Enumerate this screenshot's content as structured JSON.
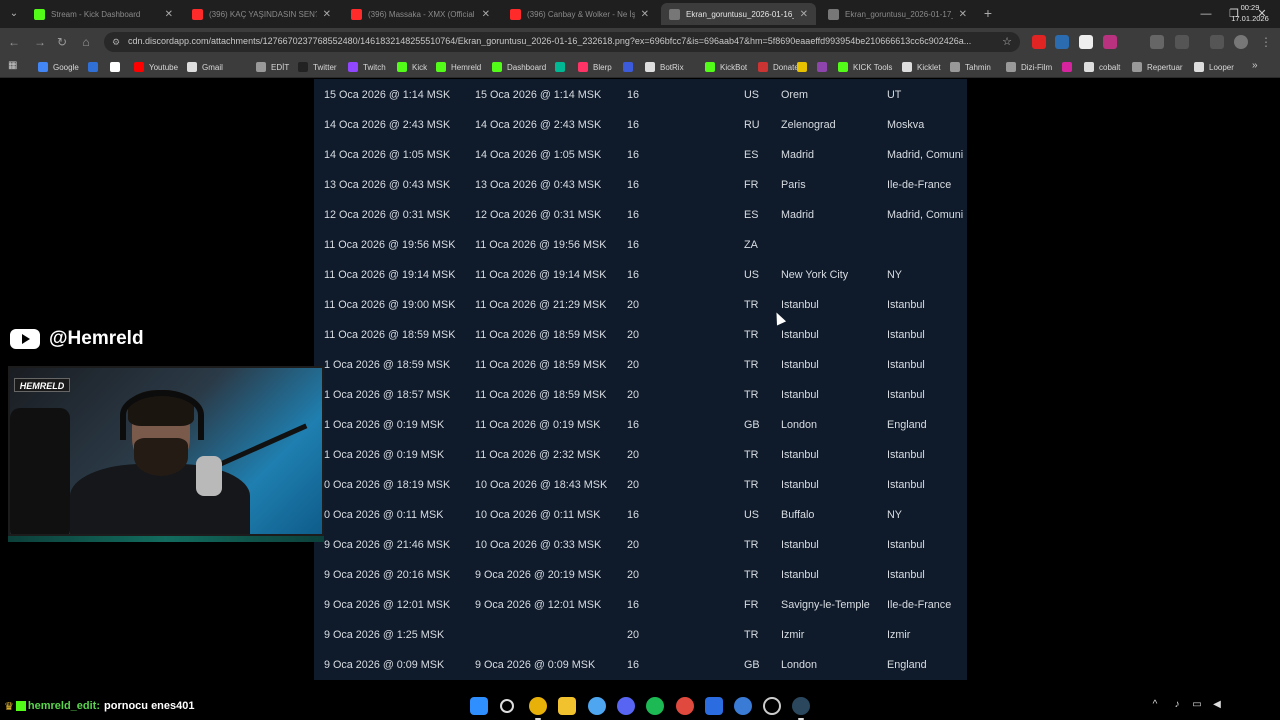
{
  "browser": {
    "tabs": [
      {
        "label": "Stream - Kick Dashboard",
        "color": "#53fc18",
        "active": false
      },
      {
        "label": "(396) KAÇ YAŞINDASIN SEN? -",
        "color": "#ff2a2a",
        "active": false
      },
      {
        "label": "(396) Massaka - XMX (Official",
        "color": "#ff2a2a",
        "active": false
      },
      {
        "label": "(396) Canbay & Wolker - Ne İş",
        "color": "#ff2a2a",
        "active": false
      },
      {
        "label": "Ekran_goruntusu_2026-01-16_",
        "color": "#777777",
        "active": true
      },
      {
        "label": "Ekran_goruntusu_2026-01-17_",
        "color": "#777777",
        "active": false
      }
    ],
    "url": "cdn.discordapp.com/attachments/1276670237768552480/1461832148255510764/Ekran_goruntusu_2026-01-16_232618.png?ex=696bfcc7&is=696aab47&hm=5f8690eaaeffd993954be210666613cc6c902426a...",
    "bookmarks": [
      {
        "label": "Google",
        "color": "#4285f4"
      },
      {
        "label": "",
        "color": "#2f6fd6"
      },
      {
        "label": "",
        "color": "#ffffff"
      },
      {
        "label": "Youtube",
        "color": "#ff0000"
      },
      {
        "label": "Gmail",
        "color": "#dddddd"
      },
      {
        "label": "EDİT",
        "color": "#999999"
      },
      {
        "label": "Twitter",
        "color": "#222222"
      },
      {
        "label": "Twitch",
        "color": "#9146ff"
      },
      {
        "label": "Kick",
        "color": "#53fc18"
      },
      {
        "label": "Hemreld",
        "color": "#53fc18"
      },
      {
        "label": "Dashboard",
        "color": "#53fc18"
      },
      {
        "label": "",
        "color": "#00b894"
      },
      {
        "label": "Blerp",
        "color": "#ff3366"
      },
      {
        "label": "",
        "color": "#3b5bdb"
      },
      {
        "label": "BotRix",
        "color": "#dddddd"
      },
      {
        "label": "KickBot",
        "color": "#53fc18"
      },
      {
        "label": "Donate",
        "color": "#cc3333"
      },
      {
        "label": "",
        "color": "#e8c200"
      },
      {
        "label": "",
        "color": "#8e44ad"
      },
      {
        "label": "KICK Tools",
        "color": "#53fc18"
      },
      {
        "label": "Kicklet",
        "color": "#dddddd"
      },
      {
        "label": "Tahmin",
        "color": "#999999"
      },
      {
        "label": "Dizi-Film",
        "color": "#999999"
      },
      {
        "label": "",
        "color": "#d6249f"
      },
      {
        "label": "cobalt",
        "color": "#dddddd"
      },
      {
        "label": "Repertuar",
        "color": "#999999"
      },
      {
        "label": "Looper",
        "color": "#dddddd"
      }
    ]
  },
  "table": {
    "rows": [
      [
        "15 Oca 2026 @ 1:14 MSK",
        "15 Oca 2026 @ 1:14 MSK",
        "16",
        "US",
        "Orem",
        "UT"
      ],
      [
        "14 Oca 2026 @ 2:43 MSK",
        "14 Oca 2026 @ 2:43 MSK",
        "16",
        "RU",
        "Zelenograd",
        "Moskva"
      ],
      [
        "14 Oca 2026 @ 1:05 MSK",
        "14 Oca 2026 @ 1:05 MSK",
        "16",
        "ES",
        "Madrid",
        "Madrid, Comuni"
      ],
      [
        "13 Oca 2026 @ 0:43 MSK",
        "13 Oca 2026 @ 0:43 MSK",
        "16",
        "FR",
        "Paris",
        "Ile-de-France"
      ],
      [
        "12 Oca 2026 @ 0:31 MSK",
        "12 Oca 2026 @ 0:31 MSK",
        "16",
        "ES",
        "Madrid",
        "Madrid, Comuni"
      ],
      [
        "11 Oca 2026 @ 19:56 MSK",
        "11 Oca 2026 @ 19:56 MSK",
        "16",
        "ZA",
        "",
        ""
      ],
      [
        "11 Oca 2026 @ 19:14 MSK",
        "11 Oca 2026 @ 19:14 MSK",
        "16",
        "US",
        "New York City",
        "NY"
      ],
      [
        "11 Oca 2026 @ 19:00 MSK",
        "11 Oca 2026 @ 21:29 MSK",
        "20",
        "TR",
        "Istanbul",
        "Istanbul"
      ],
      [
        "11 Oca 2026 @ 18:59 MSK",
        "11 Oca 2026 @ 18:59 MSK",
        "20",
        "TR",
        "Istanbul",
        "Istanbul"
      ],
      [
        "1 Oca 2026 @ 18:59 MSK",
        "11 Oca 2026 @ 18:59 MSK",
        "20",
        "TR",
        "Istanbul",
        "Istanbul"
      ],
      [
        "1 Oca 2026 @ 18:57 MSK",
        "11 Oca 2026 @ 18:59 MSK",
        "20",
        "TR",
        "Istanbul",
        "Istanbul"
      ],
      [
        "1 Oca 2026 @ 0:19 MSK",
        "11 Oca 2026 @ 0:19 MSK",
        "16",
        "GB",
        "London",
        "England"
      ],
      [
        "1 Oca 2026 @ 0:19 MSK",
        "11 Oca 2026 @ 2:32 MSK",
        "20",
        "TR",
        "Istanbul",
        "Istanbul"
      ],
      [
        "0 Oca 2026 @ 18:19 MSK",
        "10 Oca 2026 @ 18:43 MSK",
        "20",
        "TR",
        "Istanbul",
        "Istanbul"
      ],
      [
        "0 Oca 2026 @ 0:11 MSK",
        "10 Oca 2026 @ 0:11 MSK",
        "16",
        "US",
        "Buffalo",
        "NY"
      ],
      [
        "9 Oca 2026 @ 21:46 MSK",
        "10 Oca 2026 @ 0:33 MSK",
        "20",
        "TR",
        "Istanbul",
        "Istanbul"
      ],
      [
        "9 Oca 2026 @ 20:16 MSK",
        "9 Oca 2026 @ 20:19 MSK",
        "20",
        "TR",
        "Istanbul",
        "Istanbul"
      ],
      [
        "9 Oca 2026 @ 12:01 MSK",
        "9 Oca 2026 @ 12:01 MSK",
        "16",
        "FR",
        "Savigny-le-Temple",
        "Ile-de-France"
      ],
      [
        "9 Oca 2026 @ 1:25 MSK",
        "",
        "20",
        "TR",
        "Izmir",
        "Izmir"
      ],
      [
        "9 Oca 2026 @ 0:09 MSK",
        "9 Oca 2026 @ 0:09 MSK",
        "16",
        "GB",
        "London",
        "England"
      ]
    ]
  },
  "stream": {
    "youtube_handle": "@Hemreld",
    "cam_logo": "HEMRELD"
  },
  "chat": {
    "username": "hemreld_edit:",
    "message": "pornocu enes401"
  },
  "clock": {
    "time": "00:29",
    "date": "17.01.2026"
  },
  "colors": {
    "sheet_bg": "#0f1a2a",
    "kick_green": "#53fc18"
  }
}
